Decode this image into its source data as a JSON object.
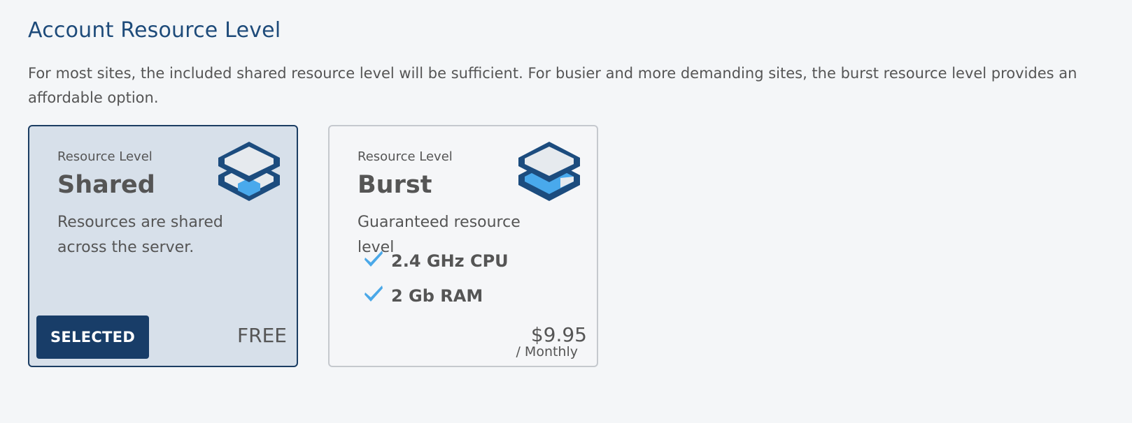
{
  "section": {
    "title": "Account Resource Level",
    "description": "For most sites, the included shared resource level will be sufficient. For busier and more demanding sites, the burst resource level provides an affordable option."
  },
  "plans": [
    {
      "label": "Resource Level",
      "name": "Shared",
      "description": "Resources are shared across the server.",
      "selected": true,
      "button_label": "SELECTED",
      "price": "FREE",
      "icon": "resource-stack-icon"
    },
    {
      "label": "Resource Level",
      "name": "Burst",
      "description": "Guaranteed resource level",
      "selected": false,
      "features": [
        "2.4 GHz CPU",
        "2 Gb RAM"
      ],
      "price": "$9.95",
      "price_period": "/ Monthly",
      "icon": "resource-stack-icon"
    }
  ],
  "colors": {
    "heading": "#1e4b7a",
    "selected_card_bg": "#d7e0ea",
    "selected_card_border": "#1b3d63",
    "button_bg": "#183d68",
    "icon_dark": "#1c4c7e",
    "icon_light": "#e6eaee",
    "icon_accent": "#49a9ec",
    "check": "#4aa8e8"
  }
}
